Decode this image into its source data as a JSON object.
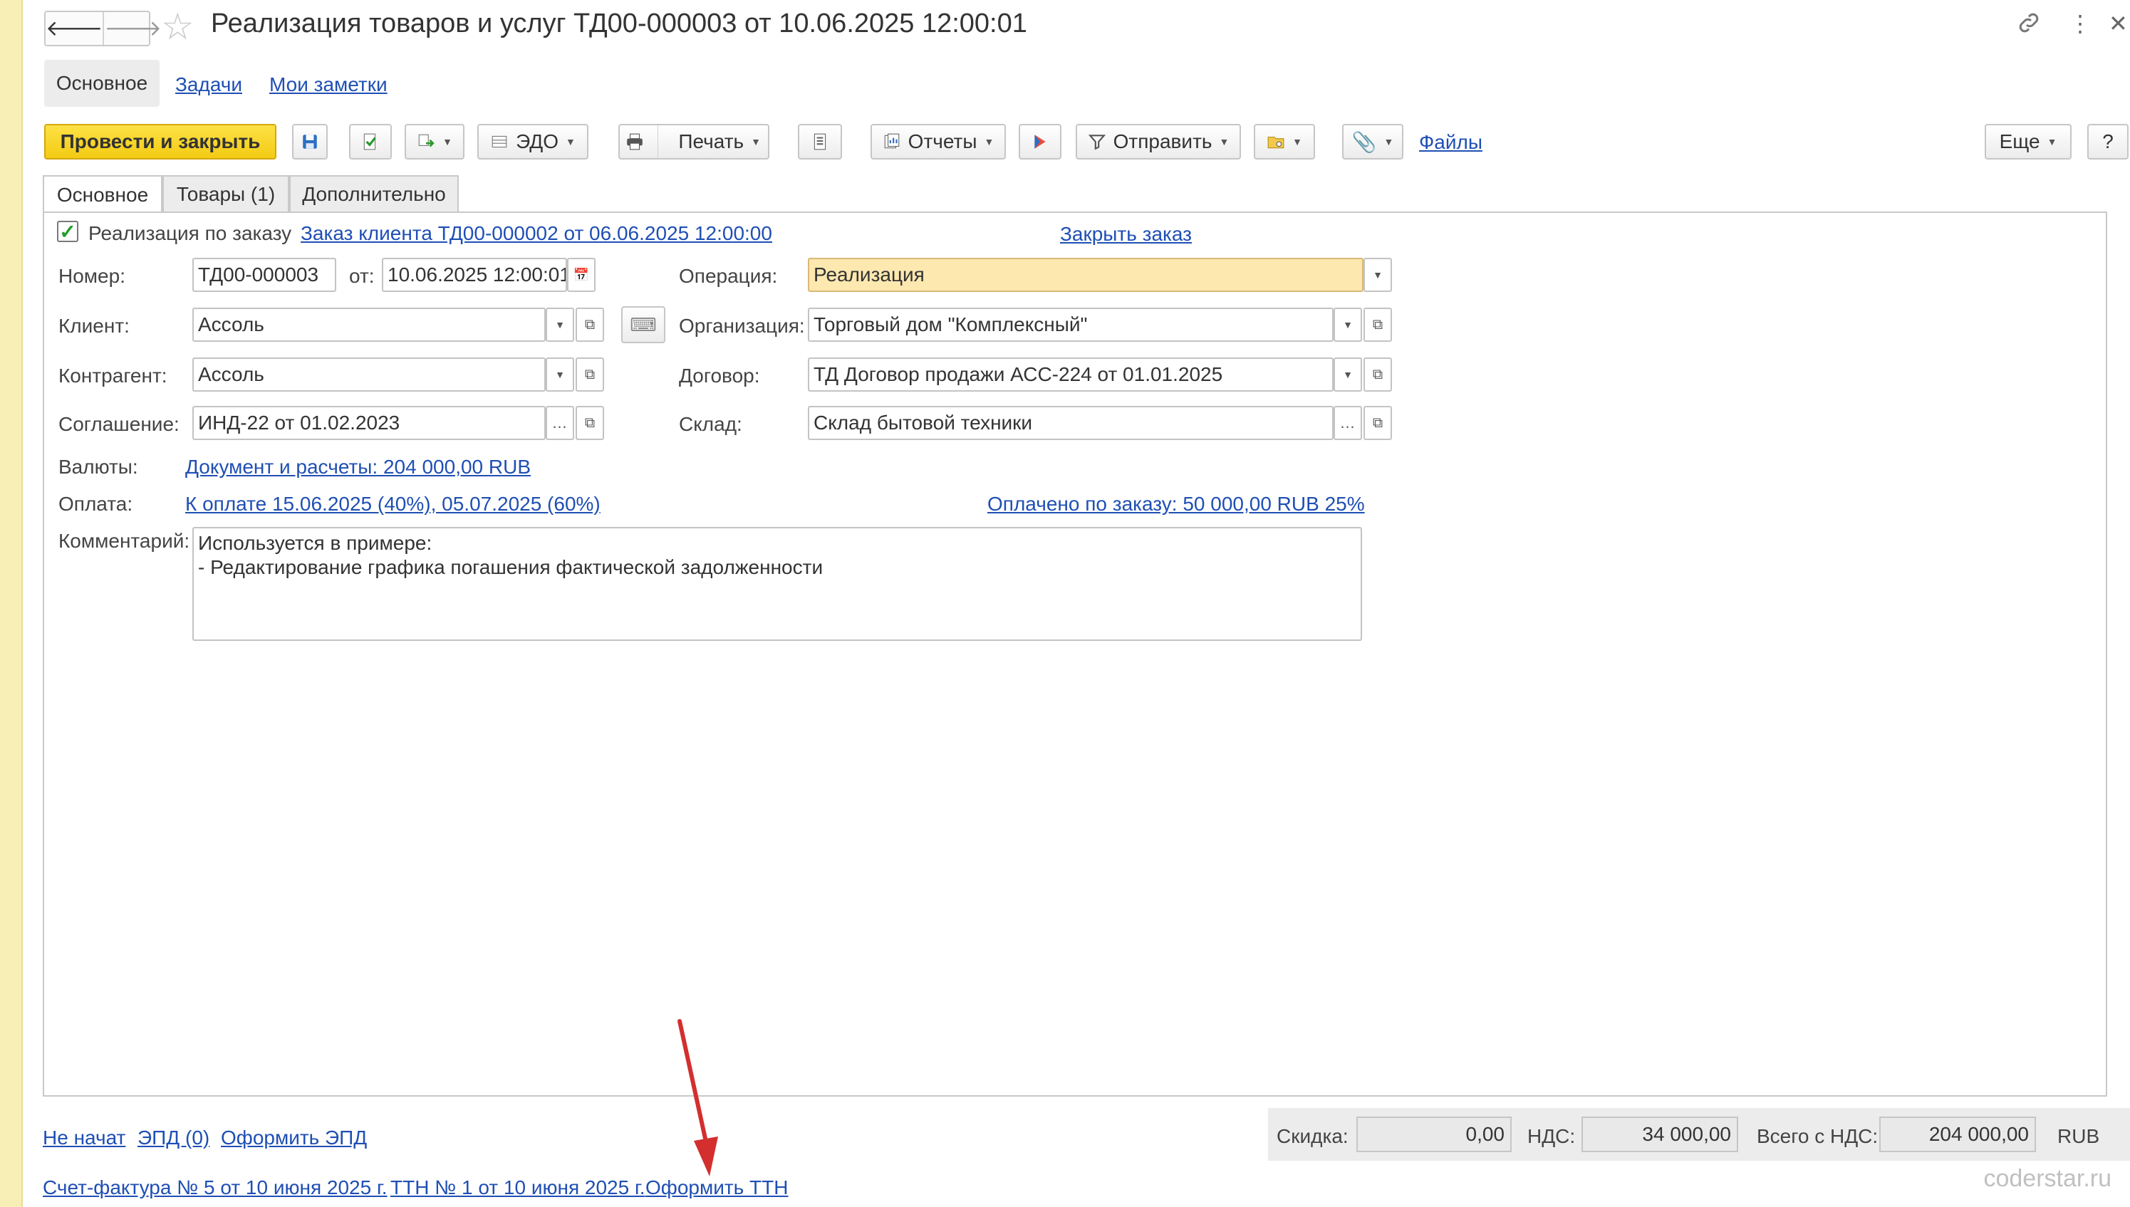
{
  "header": {
    "back_icon": "arrow-left-icon",
    "forward_icon": "arrow-right-icon",
    "favorite_icon": "star-icon",
    "title": "Реализация товаров и услуг ТД00-000003 от 10.06.2025 12:00:01",
    "link_icon": "link-icon",
    "more_icon": "more-vertical-icon",
    "close_icon": "close-icon"
  },
  "form_tabs": [
    {
      "label": "Основное",
      "active": true
    },
    {
      "label": "Задачи"
    },
    {
      "label": "Мои заметки"
    }
  ],
  "toolbar": {
    "post_close": "Провести и закрыть",
    "edo": "ЭДО",
    "print": "Печать",
    "reports": "Отчеты",
    "send": "Отправить",
    "files": "Файлы",
    "more": "Еще",
    "help": "?"
  },
  "page_tabs": [
    {
      "label": "Основное",
      "active": true
    },
    {
      "label": "Товары (1)"
    },
    {
      "label": "Дополнительно"
    }
  ],
  "form": {
    "order_check": {
      "label": "Реализация по заказу",
      "checked": true
    },
    "order_link": "Заказ клиента ТД00-000002 от 06.06.2025 12:00:00",
    "close_order": "Закрыть заказ",
    "number_label": "Номер:",
    "number": "ТД00-000003",
    "date_label": "от:",
    "date": "10.06.2025 12:00:01",
    "operation_label": "Операция:",
    "operation": "Реализация",
    "client_label": "Клиент:",
    "client": "Ассоль",
    "org_label": "Организация:",
    "organization": "Торговый дом \"Комплексный\"",
    "counterparty_label": "Контрагент:",
    "counterparty": "Ассоль",
    "contract_label": "Договор:",
    "contract": "ТД Договор продажи АСС-224 от 01.01.2025",
    "agreement_label": "Соглашение:",
    "agreement": "ИНД-22 от 01.02.2023",
    "warehouse_label": "Склад:",
    "warehouse": "Склад бытовой техники",
    "currency_label": "Валюты:",
    "currency_link": "Документ и расчеты: 204 000,00 RUB",
    "payment_label": "Оплата:",
    "payment_link": "К оплате 15.06.2025 (40%), 05.07.2025 (60%)",
    "paid_link": "Оплачено по заказу: 50 000,00 RUB 25%",
    "comment_label": "Комментарий:",
    "comment_line1": "Используется в примере:",
    "comment_line2": "- Редактирование графика погашения фактической задолженности"
  },
  "footer": {
    "status_link": "Не начат",
    "epd_link": "ЭПД (0)",
    "make_epd": "Оформить ЭПД",
    "invoice_link": "Счет-фактура № 5 от 10 июня 2025 г.",
    "ttn_link": "ТТН № 1 от 10 июня 2025 г.",
    "make_ttn": "Оформить ТТН",
    "discount_label": "Скидка:",
    "discount": "0,00",
    "vat_label": "НДС:",
    "vat": "34 000,00",
    "total_label": "Всего с НДС:",
    "total": "204 000,00",
    "currency": "RUB"
  },
  "annotation": {
    "arrow_color": "#d32f2f"
  },
  "watermark": "coderstar.ru",
  "colors": {
    "primary_button": "#f5d01c",
    "link": "#1f4fb4",
    "highlight_field": "#fde8b0",
    "check": "#1f9e2b"
  }
}
